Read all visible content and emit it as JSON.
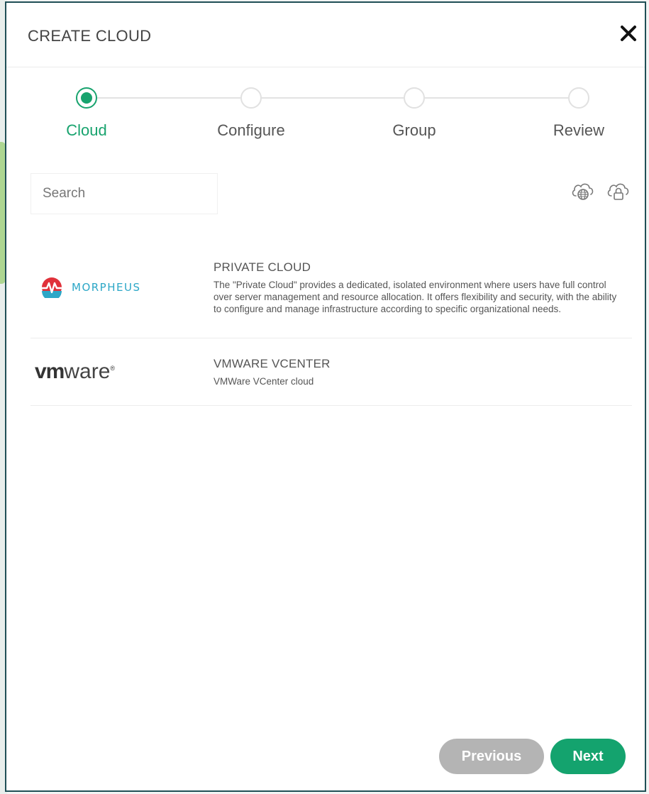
{
  "modal": {
    "title": "CREATE CLOUD"
  },
  "steps": [
    {
      "label": "Cloud",
      "active": true
    },
    {
      "label": "Configure",
      "active": false
    },
    {
      "label": "Group",
      "active": false
    },
    {
      "label": "Review",
      "active": false
    }
  ],
  "search": {
    "placeholder": "Search",
    "value": ""
  },
  "filters": {
    "icons": [
      "public-cloud-icon",
      "private-cloud-icon"
    ]
  },
  "clouds": [
    {
      "logo_text": "MORPHEUS",
      "name": "PRIVATE CLOUD",
      "description": "The \"Private Cloud\" provides a dedicated, isolated environment where users have full control over server management and resource allocation. It offers flexibility and security, with the ability to configure and manage infrastructure according to specific organizational needs."
    },
    {
      "logo_text_bold": "vm",
      "logo_text_regular": "ware",
      "name": "VMWARE VCENTER",
      "description": "VMWare VCenter cloud"
    }
  ],
  "footer": {
    "previous_label": "Previous",
    "next_label": "Next"
  },
  "colors": {
    "accent": "#18a36e",
    "disabled": "#b4b4b4",
    "border": "#1f4f56",
    "morpheus_blue": "#2ca7c7",
    "morpheus_red": "#e0313a"
  }
}
